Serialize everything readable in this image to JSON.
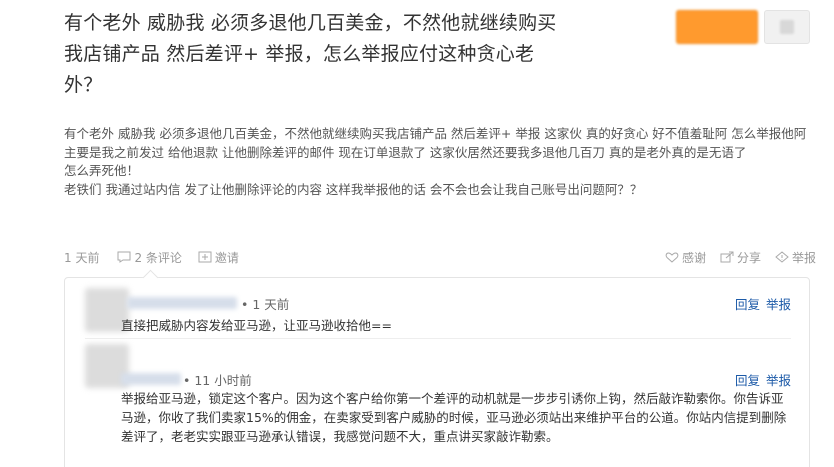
{
  "question": {
    "title": "有个老外 威胁我 必须多退他几百美金，不然他就继续购买我店铺产品 然后差评+ 举报，怎么举报应付这种贪心老外？",
    "detail": [
      "有个老外 威胁我 必须多退他几百美金，不然他就继续购买我店铺产品 然后差评+ 举报  这家伙 真的好贪心 好不值羞耻阿  怎么举报他阿  主要是我之前发过 给他退款 让他删除差评的邮件   现在订单退款了 这家伙居然还要我多退他几百刀 真的是老外真的是无语了",
      "怎么弄死他！",
      "老铁们 我通过站内信 发了让他删除评论的内容  这样我举报他的话 会不会也会让我自己账号出问题阿？？"
    ]
  },
  "meta": {
    "time": "1 天前",
    "comments": "2 条评论",
    "invite": "邀请",
    "thanks": "感谢",
    "share": "分享",
    "report": "举报"
  },
  "comments": [
    {
      "time": "• 1 天前",
      "reply": "回复",
      "report": "举报",
      "text": "直接把威胁内容发给亚马逊，让亚马逊收拾他=="
    },
    {
      "time": "• 11 小时前",
      "reply": "回复",
      "report": "举报",
      "text": "举报给亚马逊，锁定这个客户。因为这个客户给你第一个差评的动机就是一步步引诱你上钩，然后敲诈勒索你。你告诉亚马逊，你收了我们卖家15%的佣金，在卖家受到客户威胁的时候，亚马逊必须站出来维护平台的公道。你站内信提到删除差评了，老老实实跟亚马逊承认错误，我感觉问题不大，重点讲买家敲诈勒索。"
    }
  ],
  "colors": {
    "accent": "#ff9a2e",
    "link": "#1c5aa8",
    "muted": "#999999"
  }
}
